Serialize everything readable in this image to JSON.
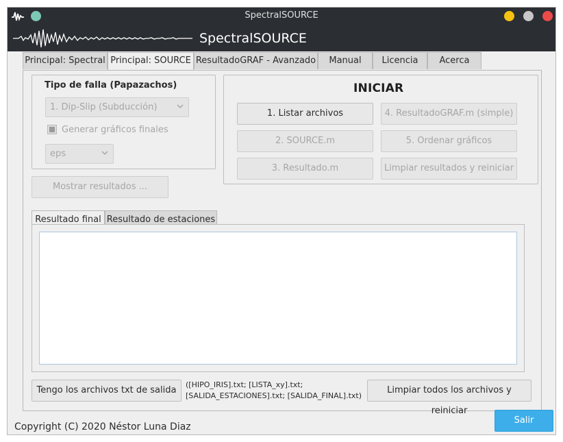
{
  "window": {
    "title": "SpectralSOURCE",
    "banner_title": "SpectralSOURCE",
    "controls": {
      "minimize_color": "#f5c211",
      "maximize_color": "#c7c7c7",
      "close_color": "#ed4a4a",
      "pin_color": "#7ec8b8"
    }
  },
  "tabs": [
    {
      "label": "Principal: Spectral"
    },
    {
      "label": "Principal: SOURCE"
    },
    {
      "label": "ResultadoGRAF - Avanzado"
    },
    {
      "label": "Manual"
    },
    {
      "label": "Licencia"
    },
    {
      "label": "Acerca"
    }
  ],
  "fault": {
    "group_label": "Tipo de falla (Papazachos)",
    "type_value": "1. Dip-Slip (Subducción)",
    "generate_label": "Generar gráficos finales",
    "format_value": "eps"
  },
  "show_results_label": "Mostrar resultados ...",
  "start": {
    "heading": "INICIAR",
    "buttons": {
      "list_files": "1. Listar archivos",
      "resultado_graf": "4. ResultadoGRAF.m (simple)",
      "source_m": "2. SOURCE.m",
      "order_graphs": "5. Ordenar gráficos",
      "resultado_m": "3. Resultado.m",
      "clear_results": "Limpiar resultados y reiniciar"
    }
  },
  "result_tabs": [
    {
      "label": "Resultado final"
    },
    {
      "label": "Resultado de estaciones"
    }
  ],
  "bottom": {
    "have_files_label": "Tengo los archivos txt de salida",
    "files_line1": "([HIPO_IRIS].txt; [LISTA_xy].txt;",
    "files_line2": "[SALIDA_ESTACIONES].txt; [SALIDA_FINAL].txt)",
    "clear_all_label": "Limpiar todos los archivos y reiniciar"
  },
  "footer": {
    "copyright": "Copyright (C) 2020 Néstor Luna Diaz",
    "exit_label": "Salir"
  }
}
